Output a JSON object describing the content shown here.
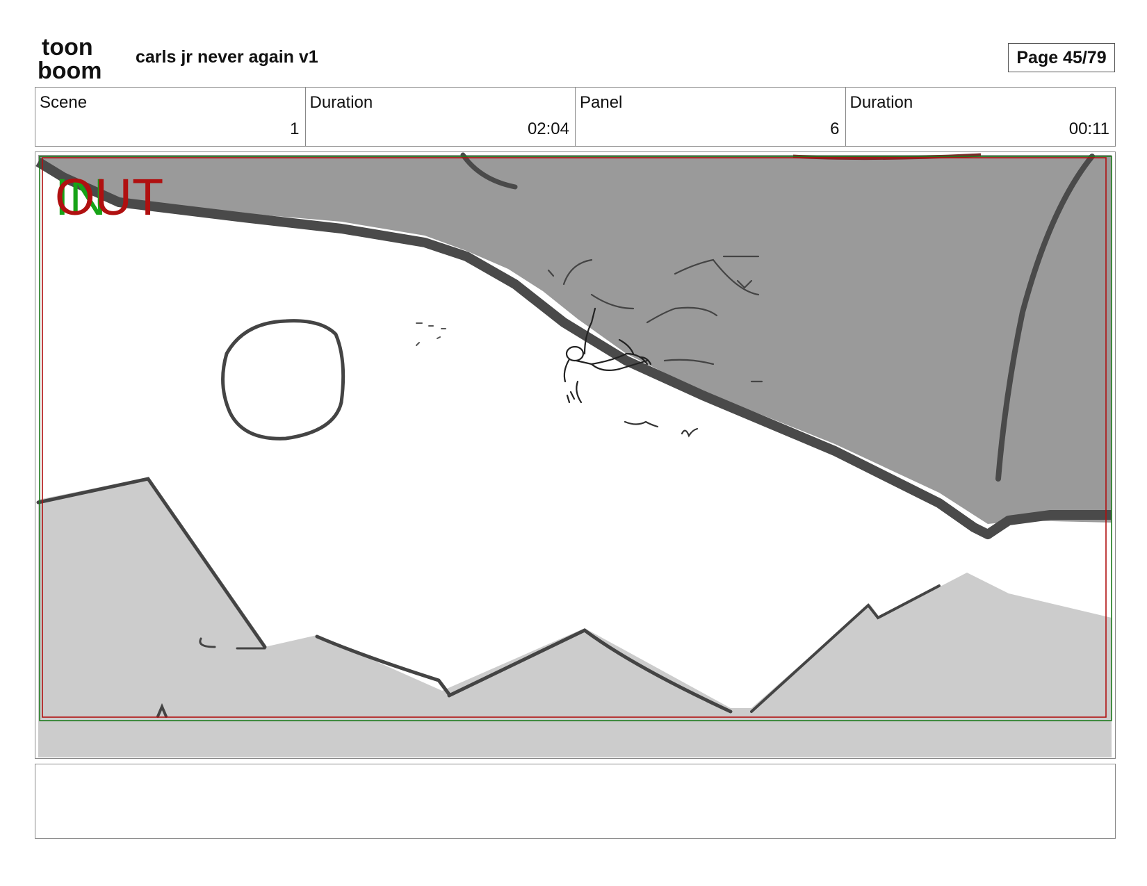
{
  "header": {
    "logo_text_top": "toon",
    "logo_text_bottom": "boom",
    "project_title": "carls jr never again v1",
    "page_label": "Page 45/79"
  },
  "info": {
    "scene_label": "Scene",
    "scene_value": "1",
    "scene_duration_label": "Duration",
    "scene_duration_value": "02:04",
    "panel_label": "Panel",
    "panel_value": "6",
    "panel_duration_label": "Duration",
    "panel_duration_value": "00:11"
  },
  "panel": {
    "in_marker": "IN",
    "out_marker": "OUT"
  },
  "notes": {
    "text": ""
  },
  "colors": {
    "in_marker": "#17a317",
    "out_marker": "#b01010",
    "cliff_fill": "#9a9a9a",
    "cliff_edge": "#4a4a4a",
    "mountain_fill": "#cccccc"
  }
}
